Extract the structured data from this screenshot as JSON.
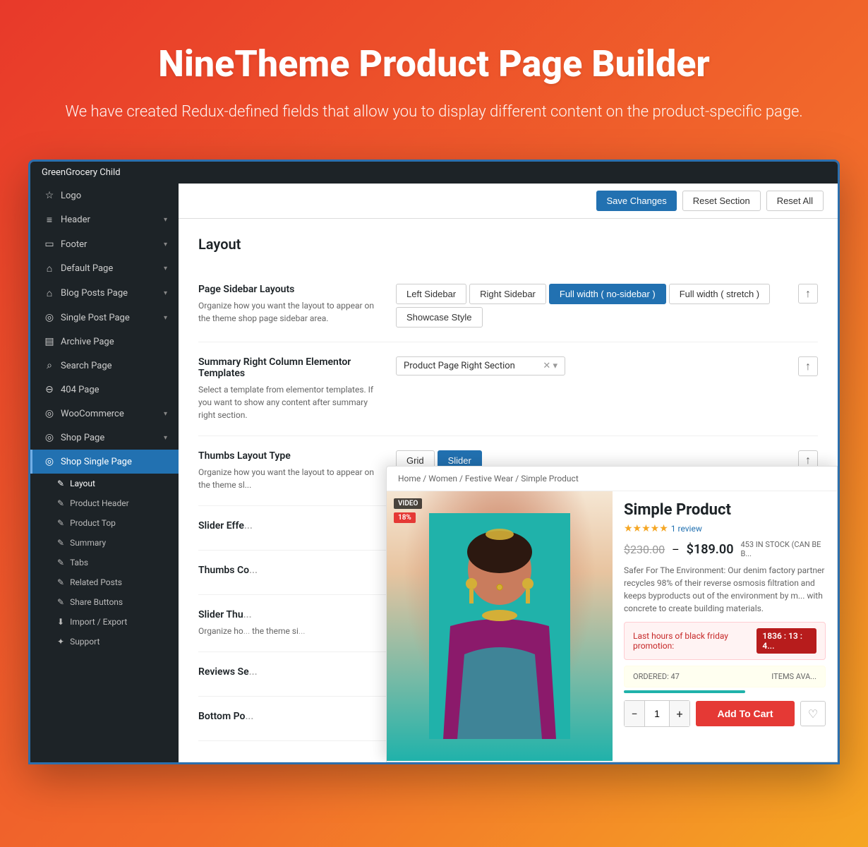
{
  "hero": {
    "title": "NineTheme Product Page Builder",
    "description": "We have created Redux-defined fields that allow you to display\ndifferent content on the product-specific page."
  },
  "admin_bar": {
    "site_name": "GreenGrocery Child"
  },
  "sidebar": {
    "items": [
      {
        "id": "logo",
        "icon": "☆",
        "label": "Logo",
        "has_chevron": false
      },
      {
        "id": "header",
        "icon": "≡",
        "label": "Header",
        "has_chevron": true
      },
      {
        "id": "footer",
        "icon": "▭",
        "label": "Footer",
        "has_chevron": true
      },
      {
        "id": "default-page",
        "icon": "⌂",
        "label": "Default Page",
        "has_chevron": true
      },
      {
        "id": "blog-posts-page",
        "icon": "⌂",
        "label": "Blog Posts Page",
        "has_chevron": true
      },
      {
        "id": "single-post-page",
        "icon": "◎",
        "label": "Single Post Page",
        "has_chevron": true
      },
      {
        "id": "archive-page",
        "icon": "▤",
        "label": "Archive Page",
        "has_chevron": false
      },
      {
        "id": "search-page",
        "icon": "⌕",
        "label": "Search Page",
        "has_chevron": false
      },
      {
        "id": "404-page",
        "icon": "⊖",
        "label": "404 Page",
        "has_chevron": false
      },
      {
        "id": "woocommerce",
        "icon": "◎",
        "label": "WooCommerce",
        "has_chevron": true
      },
      {
        "id": "shop-page",
        "icon": "◎",
        "label": "Shop Page",
        "has_chevron": true
      },
      {
        "id": "shop-single-page",
        "icon": "◎",
        "label": "Shop Single Page",
        "has_chevron": false,
        "active": true
      }
    ],
    "sub_items": [
      {
        "id": "layout",
        "icon": "✎",
        "label": "Layout",
        "active": true
      },
      {
        "id": "product-header",
        "icon": "✎",
        "label": "Product Header",
        "active": false
      },
      {
        "id": "product-top",
        "icon": "✎",
        "label": "Product Top",
        "active": false
      },
      {
        "id": "summary",
        "icon": "✎",
        "label": "Summary",
        "active": false
      },
      {
        "id": "tabs",
        "icon": "✎",
        "label": "Tabs",
        "active": false
      },
      {
        "id": "related-posts",
        "icon": "✎",
        "label": "Related Posts",
        "active": false
      },
      {
        "id": "share-buttons",
        "icon": "✎",
        "label": "Share Buttons",
        "active": false
      },
      {
        "id": "import-export",
        "icon": "⬇",
        "label": "Import / Export",
        "active": false
      },
      {
        "id": "support",
        "icon": "✦",
        "label": "Support",
        "active": false
      }
    ]
  },
  "toolbar": {
    "save_label": "Save Changes",
    "reset_section_label": "Reset Section",
    "reset_all_label": "Reset All"
  },
  "settings": {
    "title": "Layout",
    "rows": [
      {
        "id": "page-sidebar-layouts",
        "label": "Page Sidebar Layouts",
        "description": "Organize how you want the layout to appear on the theme shop page sidebar area.",
        "options": [
          {
            "id": "left-sidebar",
            "label": "Left Sidebar",
            "active": false
          },
          {
            "id": "right-sidebar",
            "label": "Right Sidebar",
            "active": false
          },
          {
            "id": "full-width-no-sidebar",
            "label": "Full width ( no-sidebar )",
            "active": true
          },
          {
            "id": "full-width-stretch",
            "label": "Full width ( stretch )",
            "active": false
          },
          {
            "id": "showcase-style",
            "label": "Showcase Style",
            "active": false
          }
        ]
      },
      {
        "id": "summary-right-column",
        "label": "Summary Right Column Elementor Templates",
        "description": "Select a template from elementor templates. If you want to show any content after summary right section.",
        "select_value": "Product Page Right Section",
        "select_placeholder": "Product Page Right Section"
      },
      {
        "id": "thumbs-layout-type",
        "label": "Thumbs Layout Type",
        "description": "Organize how you want the layout to appear on the theme sl...",
        "options": [
          {
            "id": "grid",
            "label": "Grid",
            "active": false
          },
          {
            "id": "slider",
            "label": "Slider",
            "active": true
          }
        ]
      },
      {
        "id": "slider-effect",
        "label": "Slider Effe...",
        "description": ""
      },
      {
        "id": "thumbs-count",
        "label": "Thumbs Co...",
        "description": ""
      },
      {
        "id": "slider-thumb",
        "label": "Slider Thu...",
        "description": "Organize ho... the theme si..."
      },
      {
        "id": "reviews-se",
        "label": "Reviews Se...",
        "description": ""
      },
      {
        "id": "bottom-pop",
        "label": "Bottom Po...",
        "description": ""
      }
    ]
  },
  "product_preview": {
    "breadcrumb": "Home / Women / Festive Wear / Simple Product",
    "title": "Simple Product",
    "stars": "★★★★★",
    "review_count": "1 review",
    "price_old": "$230.00",
    "price_separator": "–",
    "price_new": "$189.00",
    "stock": "453 IN STOCK (CAN BE B...",
    "description": "Safer For The Environment: Our denim factory partner recycles 98% of their reverse osmosis filtration and keeps byproducts out of the environment by m... with concrete to create building materials.",
    "promo_text": "Last hours of black friday promotion:",
    "promo_timer": "1836 : 13 : 4...",
    "ordered_label": "ORDERED: 47",
    "items_label": "ITEMS AVA...",
    "qty": "1",
    "add_to_cart": "Add To Cart",
    "video_badge": "VIDEO",
    "discount_badge": "18%"
  }
}
